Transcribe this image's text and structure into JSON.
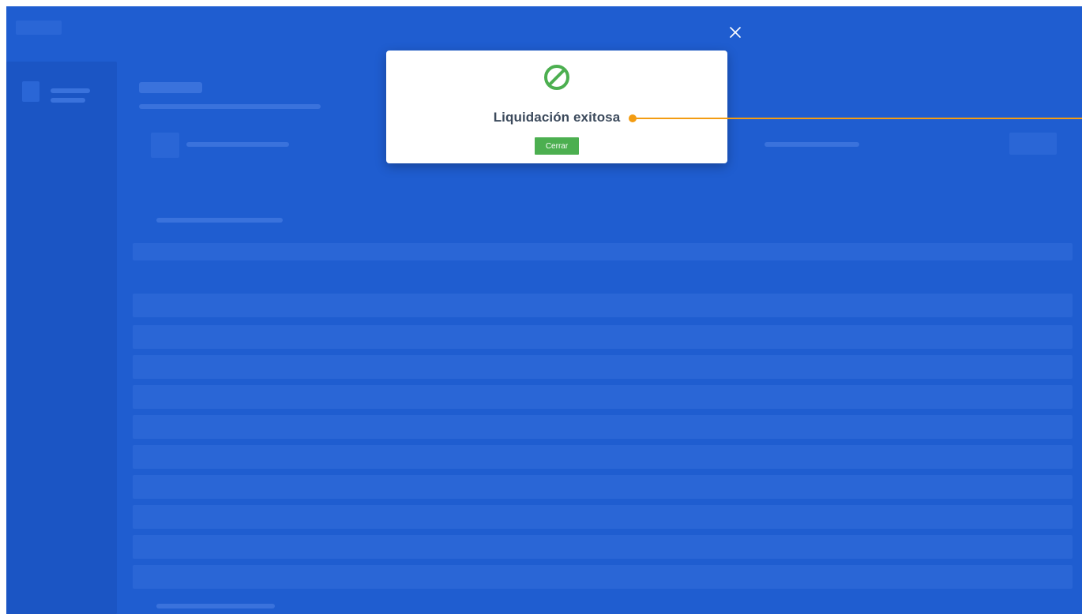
{
  "dialog": {
    "title": "Liquidación exitosa",
    "close_button_label": "Cerrar",
    "status_icon": "prohibited-circle-icon",
    "close_icon": "close-icon"
  },
  "colors": {
    "overlay": "#1f5dd0",
    "dialog_background": "#ffffff",
    "title_text": "#3c4a5c",
    "success_green": "#4caf50",
    "callout_orange": "#f39c12"
  }
}
